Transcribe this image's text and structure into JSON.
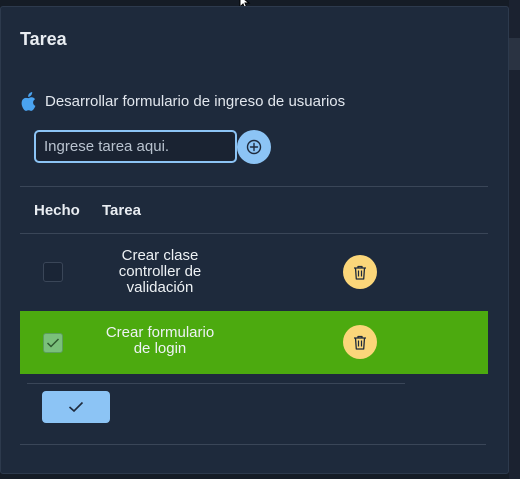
{
  "modal": {
    "title": "Tarea"
  },
  "project": {
    "icon": "apple-icon",
    "label": "Desarrollar formulario de ingreso de usuarios"
  },
  "new_task": {
    "value": "",
    "placeholder": "Ingrese tarea aqui.",
    "add_icon": "plus-circle-icon"
  },
  "table": {
    "headers": {
      "done": "Hecho",
      "task": "Tarea"
    },
    "rows": [
      {
        "done": false,
        "task": "Crear clase controller de validación",
        "action_icon": "trash-icon"
      },
      {
        "done": true,
        "task": "Crear formulario de login",
        "action_icon": "trash-icon",
        "highlight_color": "#4caa0f"
      }
    ]
  },
  "footer": {
    "confirm_icon": "check-icon"
  },
  "colors": {
    "accent": "#8cc4f5",
    "delete": "#fbd67a",
    "completed_row": "#4caa0f",
    "panel": "#1e2a3c"
  }
}
